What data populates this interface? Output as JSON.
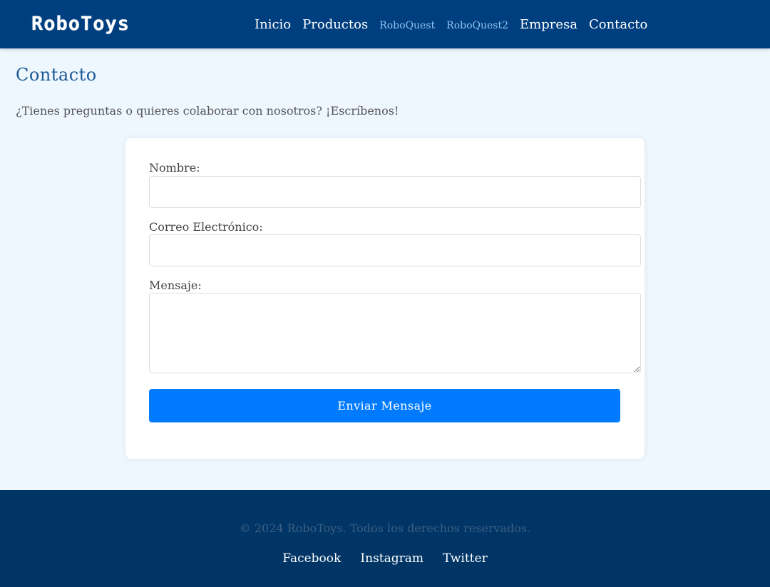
{
  "header": {
    "logo": "RoboToys",
    "nav": [
      {
        "label": "Inicio",
        "small": false
      },
      {
        "label": "Productos",
        "small": false
      },
      {
        "label": "RoboQuest",
        "small": true
      },
      {
        "label": "RoboQuest2",
        "small": true
      },
      {
        "label": "Empresa",
        "small": false
      },
      {
        "label": "Contacto",
        "small": false
      }
    ]
  },
  "main": {
    "title": "Contacto",
    "intro": "¿Tienes preguntas o quieres colaborar con nosotros? ¡Escríbenos!",
    "form": {
      "name_label": "Nombre:",
      "name_value": "",
      "email_label": "Correo Electrónico:",
      "email_value": "",
      "message_label": "Mensaje:",
      "message_value": "",
      "submit_label": "Enviar Mensaje"
    }
  },
  "footer": {
    "copyright": "© 2024 RoboToys. Todos los derechos reservados.",
    "social": [
      "Facebook",
      "Instagram",
      "Twitter"
    ]
  },
  "colors": {
    "header_bg": "#003f7f",
    "page_bg": "#eef6fe",
    "accent": "#007bff",
    "footer_bg": "#003566"
  }
}
